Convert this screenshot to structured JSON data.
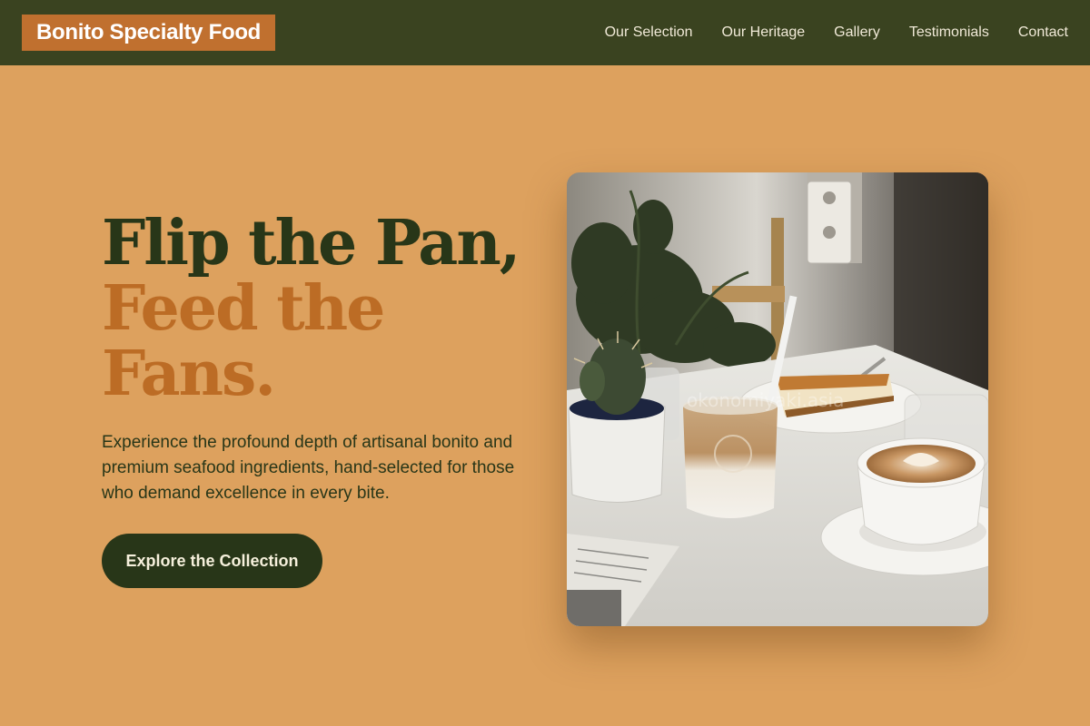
{
  "header": {
    "brand": "Bonito Specialty Food",
    "nav": [
      {
        "label": "Our Selection"
      },
      {
        "label": "Our Heritage"
      },
      {
        "label": "Gallery"
      },
      {
        "label": "Testimonials"
      },
      {
        "label": "Contact"
      }
    ]
  },
  "hero": {
    "title_line1": "Flip the Pan,",
    "title_line2": "Feed the Fans.",
    "description": "Experience the profound depth of artisanal bonito and premium seafood ingredients, hand-selected for those who demand excellence in every bite.",
    "cta_label": "Explore the Collection",
    "image": {
      "watermark": "okonomiyaki.asia"
    }
  },
  "colors": {
    "background": "#dda15e",
    "header": "#3a4320",
    "brand_badge": "#c0702f",
    "title_dark": "#283618",
    "title_accent": "#bc6c25",
    "cta": "#283618"
  }
}
